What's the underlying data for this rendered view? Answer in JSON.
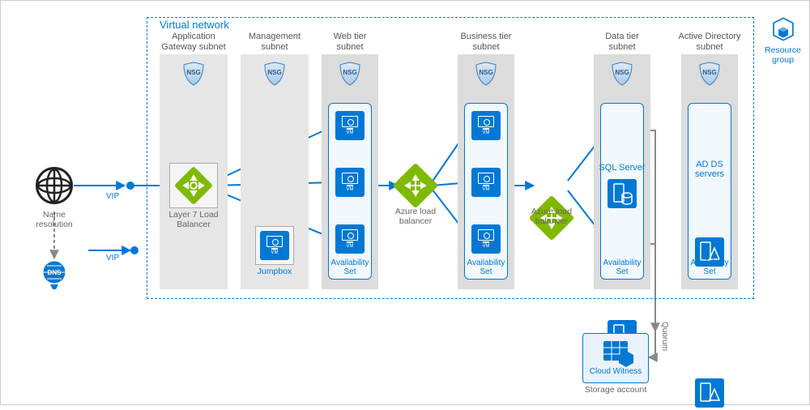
{
  "vnet": {
    "label": "Virtual network"
  },
  "subnets": {
    "appgw": "Application\nGateway subnet",
    "mgmt": "Management\nsubnet",
    "web": "Web tier\nsubnet",
    "biz": "Business tier\nsubnet",
    "data": "Data tier\nsubnet",
    "ad": "Active Directory\nsubnet"
  },
  "nsg": "NSG",
  "vm": "VM",
  "labels": {
    "layer7": "Layer 7 Load\nBalancer",
    "jumpbox": "Jumpbox",
    "avail": "Availability\nSet",
    "azlb": "Azure load\nbalancer",
    "sql": "SQL Server",
    "adds": "AD DS\nservers",
    "name_resolution": "Name\nresolution",
    "vip": "VIP",
    "cloud_witness": "Cloud Witness",
    "storage_account": "Storage account",
    "quorum": "Quorum",
    "resource_group": "Resource\ngroup",
    "dns": "DNS"
  }
}
